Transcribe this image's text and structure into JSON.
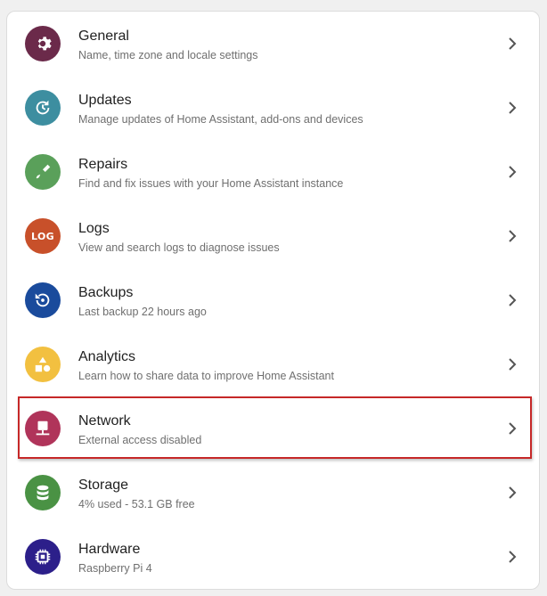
{
  "settings": {
    "items": [
      {
        "id": "general",
        "title": "General",
        "subtitle": "Name, time zone and locale settings",
        "icon": "gear-icon",
        "color": "#6b2a4a"
      },
      {
        "id": "updates",
        "title": "Updates",
        "subtitle": "Manage updates of Home Assistant, add-ons and devices",
        "icon": "update-icon",
        "color": "#3d8ea0"
      },
      {
        "id": "repairs",
        "title": "Repairs",
        "subtitle": "Find and fix issues with your Home Assistant instance",
        "icon": "screwdriver-icon",
        "color": "#5aa05a"
      },
      {
        "id": "logs",
        "title": "Logs",
        "subtitle": "View and search logs to diagnose issues",
        "icon": "log-icon",
        "icon_text": "LOG",
        "color": "#c8502a"
      },
      {
        "id": "backups",
        "title": "Backups",
        "subtitle": "Last backup 22 hours ago",
        "icon": "backup-icon",
        "color": "#1a4b9c"
      },
      {
        "id": "analytics",
        "title": "Analytics",
        "subtitle": "Learn how to share data to improve Home Assistant",
        "icon": "shapes-icon",
        "color": "#f2c040"
      },
      {
        "id": "network",
        "title": "Network",
        "subtitle": "External access disabled",
        "icon": "network-icon",
        "color": "#b0345a"
      },
      {
        "id": "storage",
        "title": "Storage",
        "subtitle": "4% used - 53.1 GB free",
        "icon": "database-icon",
        "color": "#4a9244"
      },
      {
        "id": "hardware",
        "title": "Hardware",
        "subtitle": "Raspberry Pi 4",
        "icon": "chip-icon",
        "color": "#2c1f8a"
      }
    ],
    "highlighted_item": "network",
    "highlight_color": "#c62828"
  }
}
